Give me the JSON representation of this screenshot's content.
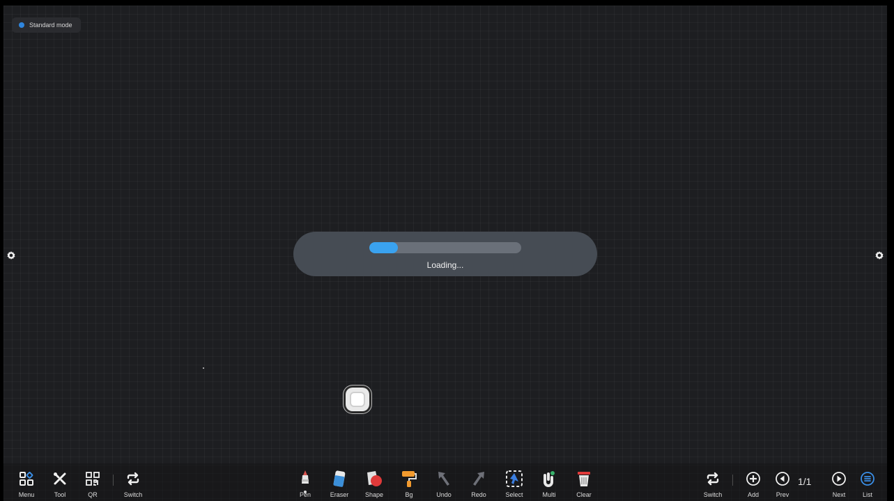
{
  "mode_badge": {
    "label": "Standard mode",
    "dot_color": "#2f86de"
  },
  "loading": {
    "text": "Loading...",
    "progress": 0.19,
    "accent_color": "#3aa2ef"
  },
  "left_toolbar": [
    {
      "id": "menu",
      "label": "Menu",
      "icon": "menu-grid-icon"
    },
    {
      "id": "tool",
      "label": "Tool",
      "icon": "tools-icon"
    },
    {
      "id": "qr",
      "label": "QR",
      "icon": "qr-code-icon"
    },
    {
      "id": "switch",
      "label": "Switch",
      "icon": "switch-arrows-icon"
    }
  ],
  "center_toolbar": [
    {
      "id": "pen",
      "label": "Pen",
      "icon": "pen-icon"
    },
    {
      "id": "eraser",
      "label": "Eraser",
      "icon": "eraser-icon"
    },
    {
      "id": "shape",
      "label": "Shape",
      "icon": "shape-icon"
    },
    {
      "id": "bg",
      "label": "Bg",
      "icon": "paint-roller-icon"
    },
    {
      "id": "undo",
      "label": "Undo",
      "icon": "undo-arrow-icon"
    },
    {
      "id": "redo",
      "label": "Redo",
      "icon": "redo-arrow-icon"
    },
    {
      "id": "select",
      "label": "Select",
      "icon": "select-icon"
    },
    {
      "id": "multi",
      "label": "Multi",
      "icon": "multi-touch-icon"
    },
    {
      "id": "clear",
      "label": "Clear",
      "icon": "trash-icon"
    }
  ],
  "right_toolbar": [
    {
      "id": "switch",
      "label": "Switch",
      "icon": "switch-arrows-icon"
    },
    {
      "id": "add",
      "label": "Add",
      "icon": "add-page-icon"
    },
    {
      "id": "prev",
      "label": "Prev",
      "icon": "prev-page-icon"
    },
    {
      "id": "next",
      "label": "Next",
      "icon": "next-page-icon"
    },
    {
      "id": "list",
      "label": "List",
      "icon": "page-list-icon"
    }
  ],
  "page_indicator": "1/1"
}
